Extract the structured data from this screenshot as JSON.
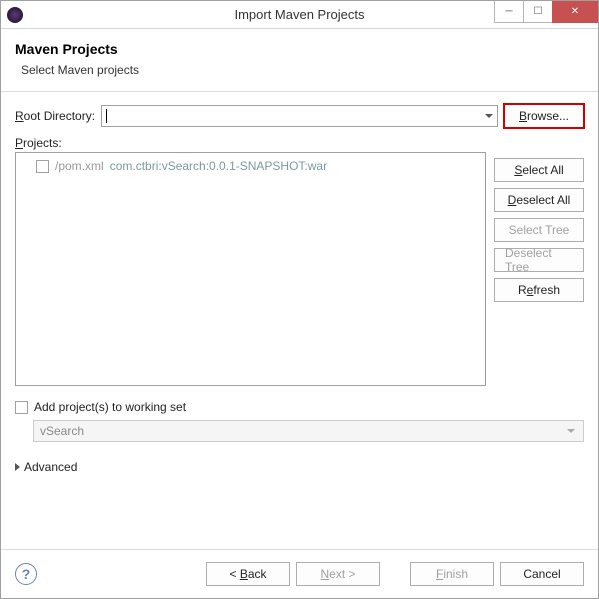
{
  "window": {
    "title": "Import Maven Projects"
  },
  "header": {
    "title": "Maven Projects",
    "subtitle": "Select Maven projects"
  },
  "rootDir": {
    "label": "Root Directory:",
    "value": "",
    "browse": "Browse..."
  },
  "projects": {
    "label": "Projects:",
    "items": [
      {
        "path": "/pom.xml",
        "coord": "com.ctbri:vSearch:0.0.1-SNAPSHOT:war",
        "checked": false
      }
    ]
  },
  "sideButtons": {
    "selectAll": "Select All",
    "deselectAll": "Deselect All",
    "selectTree": "Select Tree",
    "deselectTree": "Deselect Tree",
    "refresh": "Refresh"
  },
  "workingSet": {
    "checkbox": "Add project(s) to working set",
    "selected": "vSearch"
  },
  "advanced": {
    "label": "Advanced"
  },
  "footer": {
    "back": "< Back",
    "next": "Next >",
    "finish": "Finish",
    "cancel": "Cancel"
  }
}
